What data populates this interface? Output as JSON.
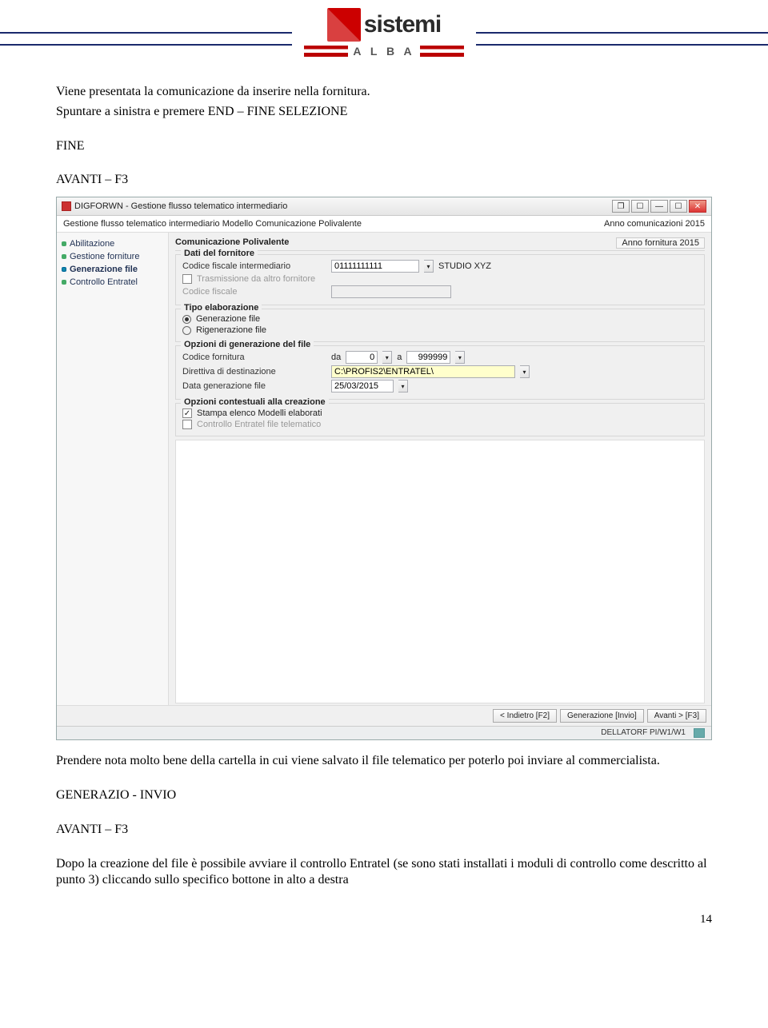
{
  "headerLogo": {
    "brand": "sistemi",
    "sub": "A L B A"
  },
  "text": {
    "p1": "Viene presentata la comunicazione da inserire nella fornitura.",
    "p2": "Spuntare a sinistra e premere END – FINE SELEZIONE",
    "p3": "FINE",
    "p4": "AVANTI – F3",
    "p5": "Prendere nota molto bene della cartella in cui viene salvato il file telematico per poterlo poi inviare al commercialista.",
    "p6": "GENERAZIO - INVIO",
    "p7": "AVANTI – F3",
    "p8": "Dopo la creazione del file è possibile avviare il controllo Entratel (se sono stati installati i moduli di controllo come descritto al punto 3) cliccando sullo specifico bottone in alto a destra"
  },
  "win": {
    "title": "DIGFORWN - Gestione flusso telematico intermediario",
    "subtitle_left": "Gestione flusso telematico intermediario Modello Comunicazione Polivalente",
    "subtitle_right": "Anno comunicazioni 2015",
    "sidebar": [
      "Abilitazione",
      "Gestione forniture",
      "Generazione file",
      "Controllo Entratel"
    ],
    "sidebar_sel_index": 2,
    "panel_title": "Comunicazione Polivalente",
    "panel_right": "Anno fornitura 2015",
    "grp_dati": {
      "title": "Dati del fornitore",
      "cf_label": "Codice fiscale intermediario",
      "cf_value": "01111111111",
      "cf_desc": "STUDIO XYZ",
      "trasm_label": "Trasmissione da altro fornitore",
      "codfisc_label": "Codice fiscale"
    },
    "grp_tipo": {
      "title": "Tipo elaborazione",
      "opt1": "Generazione file",
      "opt2": "Rigenerazione file"
    },
    "grp_opz": {
      "title": "Opzioni di generazione del file",
      "codforn_label": "Codice fornitura",
      "da": "da",
      "da_val": "0",
      "a": "a",
      "a_val": "999999",
      "dir_label": "Direttiva di destinazione",
      "dir_val": "C:\\PROFIS2\\ENTRATEL\\",
      "data_label": "Data generazione file",
      "data_val": "25/03/2015"
    },
    "grp_ctx": {
      "title": "Opzioni contestuali alla creazione",
      "opt1": "Stampa elenco Modelli elaborati",
      "opt2": "Controllo Entratel file telematico"
    },
    "footer": {
      "b1": "< Indietro [F2]",
      "b2": "Generazione [Invio]",
      "b3": "Avanti > [F3]"
    },
    "status": "DELLATORF PI/W1/W1"
  },
  "pageNumber": "14"
}
